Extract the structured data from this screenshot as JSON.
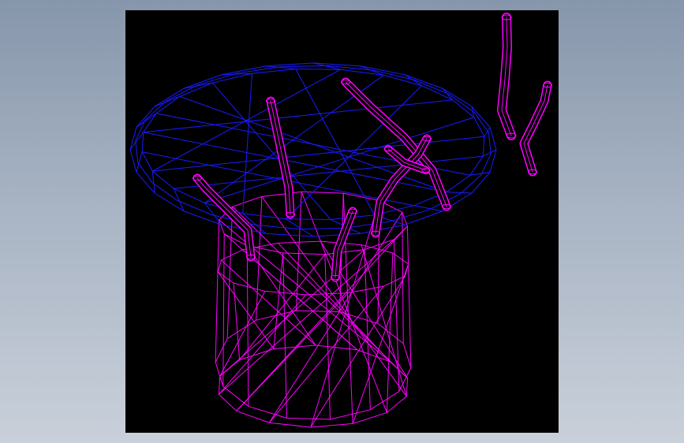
{
  "colors": {
    "background_top": "#8696ab",
    "background_bottom": "#c9d0da",
    "viewport_background": "#000000",
    "disc_wireframe": "#1a1aff",
    "cylinder_wireframe": "#ff00ff",
    "tube_wireframe": "#ff00ff"
  },
  "scene": {
    "icon": "wireframe-3d-model",
    "parts": [
      "blue-disc-wireframe",
      "magenta-cylinder-wireframe",
      "magenta-tube-wireframes"
    ]
  }
}
